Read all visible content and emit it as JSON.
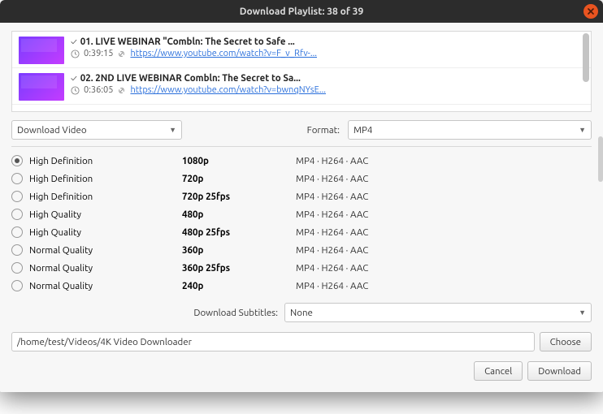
{
  "title": "Download Playlist: 38 of 39",
  "playlist": [
    {
      "title": "01. LIVE WEBINAR \"Combln: The Secret to Safe ...",
      "duration": "0:39:15",
      "url": "https://www.youtube.com/watch?v=F_v_Rfv-..."
    },
    {
      "title": "02. 2ND LIVE WEBINAR Combln: The Secret to Sa...",
      "duration": "0:36:05",
      "url": "https://www.youtube.com/watch?v=bwnqNYsE..."
    }
  ],
  "download_mode": "Download Video",
  "format_label": "Format:",
  "format_value": "MP4",
  "qualities": [
    {
      "label": "High Definition",
      "res": "1080p",
      "codec": "MP4 · H264 · AAC",
      "selected": true
    },
    {
      "label": "High Definition",
      "res": "720p",
      "codec": "MP4 · H264 · AAC",
      "selected": false
    },
    {
      "label": "High Definition",
      "res": "720p 25fps",
      "codec": "MP4 · H264 · AAC",
      "selected": false
    },
    {
      "label": "High Quality",
      "res": "480p",
      "codec": "MP4 · H264 · AAC",
      "selected": false
    },
    {
      "label": "High Quality",
      "res": "480p 25fps",
      "codec": "MP4 · H264 · AAC",
      "selected": false
    },
    {
      "label": "Normal Quality",
      "res": "360p",
      "codec": "MP4 · H264 · AAC",
      "selected": false
    },
    {
      "label": "Normal Quality",
      "res": "360p 25fps",
      "codec": "MP4 · H264 · AAC",
      "selected": false
    },
    {
      "label": "Normal Quality",
      "res": "240p",
      "codec": "MP4 · H264 · AAC",
      "selected": false
    }
  ],
  "subtitles_label": "Download Subtitles:",
  "subtitles_value": "None",
  "path": "/home/test/Videos/4K Video Downloader",
  "choose_label": "Choose",
  "cancel_label": "Cancel",
  "download_label": "Download"
}
